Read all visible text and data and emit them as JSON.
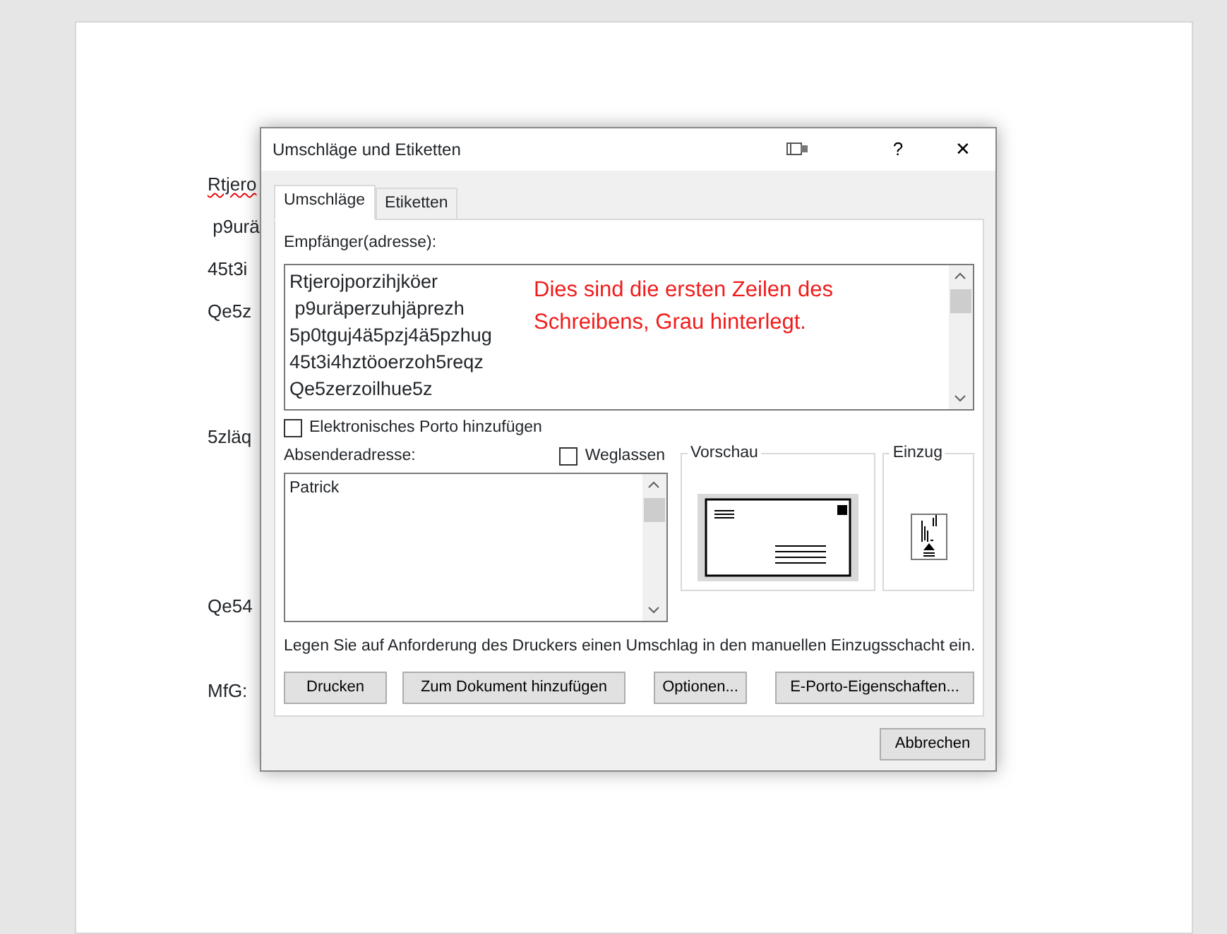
{
  "document": {
    "lines": [
      {
        "text": "Rtjero",
        "misspelled": true
      },
      {
        "text": " p9urä",
        "misspelled": false
      },
      {
        "text": "45t3i",
        "misspelled": false
      },
      {
        "text": "Qe5z",
        "misspelled": false
      },
      {
        "text": "5zläq",
        "misspelled": false
      },
      {
        "text": "Qe54",
        "misspelled": false
      },
      {
        "text": "MfG:",
        "misspelled": false
      }
    ]
  },
  "dialog": {
    "title": "Umschläge und Etiketten",
    "title_buttons": [
      "?",
      "✕"
    ],
    "tabs": [
      {
        "label": "Umschläge",
        "selected": true
      },
      {
        "label": "Etiketten",
        "selected": false
      }
    ],
    "recipient": {
      "label": "Empfänger(adresse):",
      "value": "Rtjerojporzihjköer\n p9uräperzuhjäprezh\n5p0tguj4ä5pzj4ä5pzhug\n45t3i4hztöoerzoh5reqz\nQe5zerzoilhue5z",
      "annotation": "Dies sind die ersten Zeilen des Schreibens, Grau hinterlegt."
    },
    "epostage": {
      "label": "Elektronisches Porto hinzufügen",
      "checked": false
    },
    "sender": {
      "label": "Absenderadresse:",
      "value": "Patrick"
    },
    "omit": {
      "label": "Weglassen",
      "checked": false
    },
    "preview": {
      "label": "Vorschau"
    },
    "feed": {
      "label": "Einzug"
    },
    "hint": "Legen Sie auf Anforderung des Druckers einen Umschlag in den manuellen Einzugsschacht ein.",
    "buttons": [
      "Drucken",
      "Zum Dokument hinzufügen",
      "Optionen...",
      "E-Porto-Eigenschaften..."
    ],
    "cancel": "Abbrechen"
  }
}
